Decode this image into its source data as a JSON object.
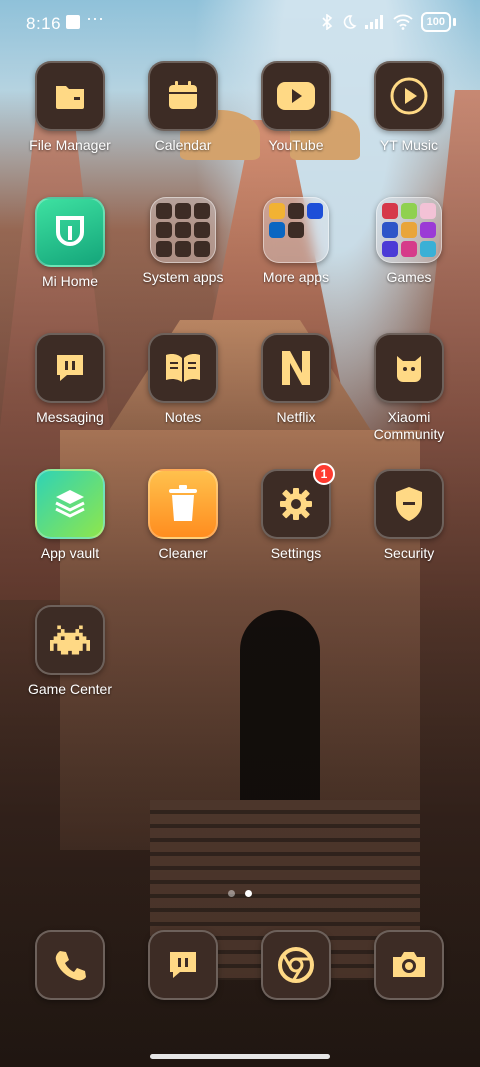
{
  "status_bar": {
    "time": "8:16",
    "more": "···",
    "battery": "100",
    "icons": [
      "bluetooth-icon",
      "moon-icon",
      "signal-icon",
      "wifi-icon",
      "battery-icon"
    ]
  },
  "apps": [
    {
      "label": "File Manager",
      "icon": "folder-icon"
    },
    {
      "label": "Calendar",
      "icon": "calendar-icon"
    },
    {
      "label": "YouTube",
      "icon": "youtube-icon"
    },
    {
      "label": "YT Music",
      "icon": "yt-music-icon"
    },
    {
      "label": "Mi Home",
      "icon": "mi-home-icon"
    },
    {
      "label": "System apps",
      "icon": "folder-grid-icon"
    },
    {
      "label": "More apps",
      "icon": "folder-grid-icon"
    },
    {
      "label": "Games",
      "icon": "folder-grid-icon"
    },
    {
      "label": "Messaging",
      "icon": "message-icon"
    },
    {
      "label": "Notes",
      "icon": "notes-icon"
    },
    {
      "label": "Netflix",
      "icon": "netflix-icon"
    },
    {
      "label": "Xiaomi Community",
      "icon": "community-icon"
    },
    {
      "label": "App vault",
      "icon": "layers-icon"
    },
    {
      "label": "Cleaner",
      "icon": "trash-icon"
    },
    {
      "label": "Settings",
      "icon": "gear-icon",
      "badge": "1"
    },
    {
      "label": "Security",
      "icon": "shield-icon"
    },
    {
      "label": "Game Center",
      "icon": "invader-icon"
    }
  ],
  "dock": [
    {
      "name": "phone",
      "icon": "phone-icon"
    },
    {
      "name": "messaging",
      "icon": "message-icon"
    },
    {
      "name": "chrome",
      "icon": "chrome-icon"
    },
    {
      "name": "camera",
      "icon": "camera-icon"
    }
  ],
  "pager": {
    "pages": 2,
    "current": 2
  },
  "colors": {
    "icon_bg": "#3d2c25",
    "icon_glyph": "#ffd985",
    "badge": "#ff3b30"
  }
}
